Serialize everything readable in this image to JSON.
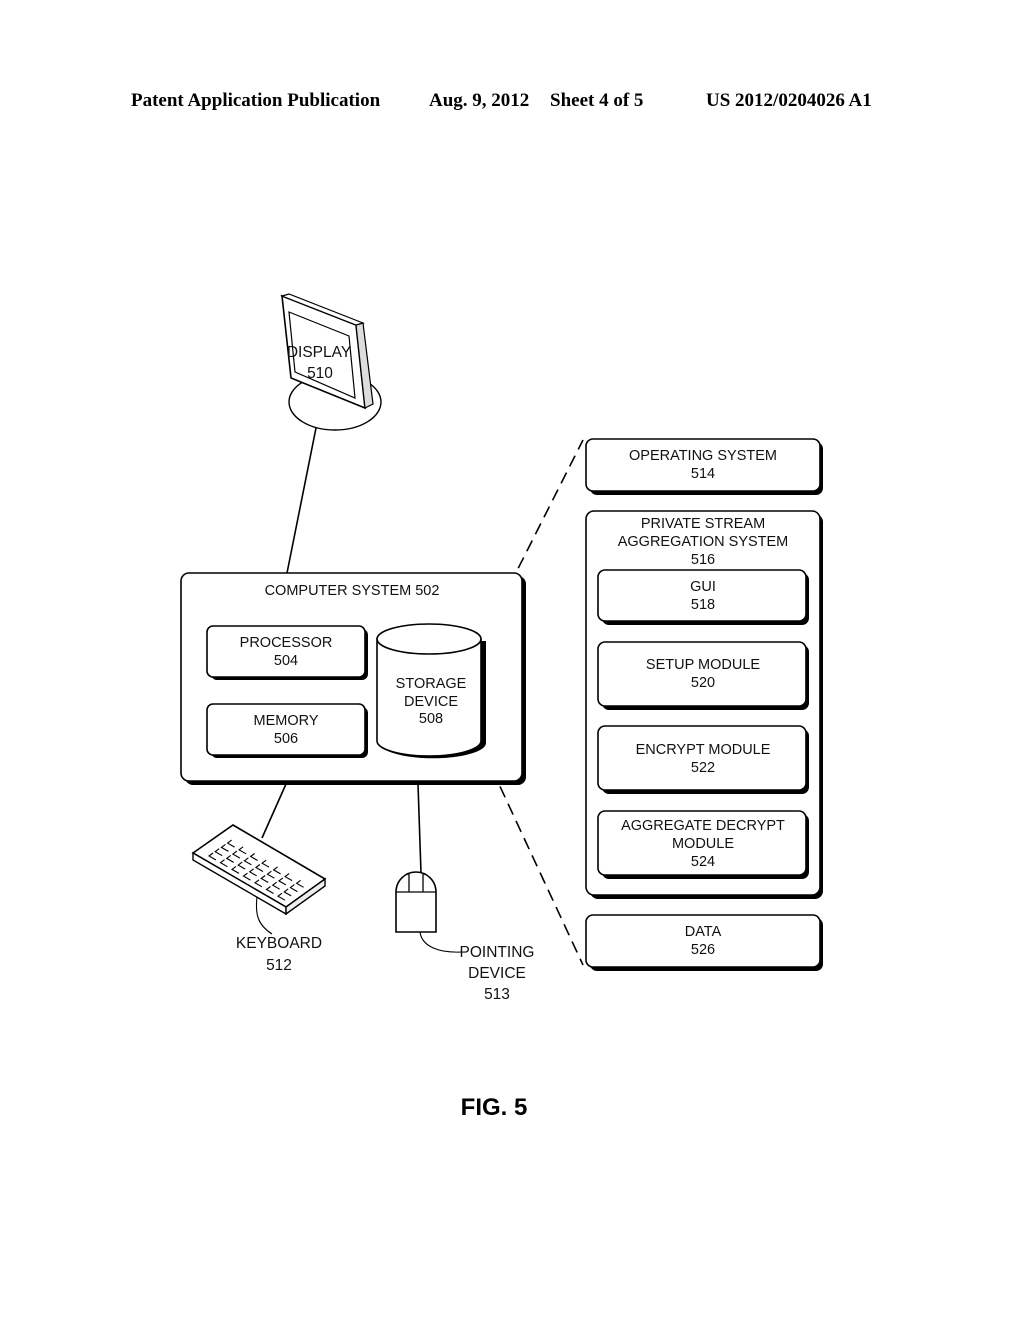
{
  "header": {
    "publication": "Patent Application Publication",
    "date": "Aug. 9, 2012",
    "sheet": "Sheet 4 of 5",
    "number": "US 2012/0204026 A1"
  },
  "diagram": {
    "display": {
      "name": "DISPLAY",
      "ref": "510"
    },
    "computer_system": {
      "label": "COMPUTER SYSTEM 502"
    },
    "processor": {
      "name": "PROCESSOR",
      "ref": "504"
    },
    "memory": {
      "name": "MEMORY",
      "ref": "506"
    },
    "storage": {
      "line1": "STORAGE",
      "line2": "DEVICE",
      "ref": "508"
    },
    "keyboard": {
      "name": "KEYBOARD",
      "ref": "512"
    },
    "pointing_device": {
      "line1": "POINTING",
      "line2": "DEVICE",
      "ref": "513"
    },
    "operating_system": {
      "name": "OPERATING SYSTEM",
      "ref": "514"
    },
    "psa_system": {
      "line1": "PRIVATE STREAM",
      "line2": "AGGREGATION SYSTEM",
      "ref": "516"
    },
    "gui": {
      "name": "GUI",
      "ref": "518"
    },
    "setup_module": {
      "name": "SETUP MODULE",
      "ref": "520"
    },
    "encrypt_module": {
      "name": "ENCRYPT MODULE",
      "ref": "522"
    },
    "aggregate_decrypt_module": {
      "line1": "AGGREGATE DECRYPT",
      "line2": "MODULE",
      "ref": "524"
    },
    "data": {
      "name": "DATA",
      "ref": "526"
    }
  },
  "figure_label": "FIG. 5"
}
